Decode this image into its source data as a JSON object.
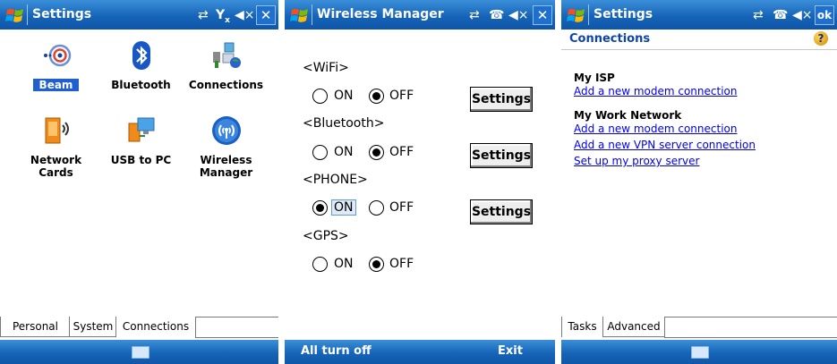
{
  "screen1": {
    "title": "Settings",
    "apps": [
      {
        "label": "Beam",
        "icon": "beam-icon"
      },
      {
        "label": "Bluetooth",
        "icon": "bluetooth-icon"
      },
      {
        "label": "Connections",
        "icon": "connections-icon"
      },
      {
        "label": "Network Cards",
        "icon": "network-cards-icon"
      },
      {
        "label": "USB to PC",
        "icon": "usb-to-pc-icon"
      },
      {
        "label": "Wireless Manager",
        "icon": "wireless-manager-icon"
      }
    ],
    "tabs": [
      "Personal",
      "System",
      "Connections"
    ]
  },
  "screen2": {
    "title": "Wireless Manager",
    "wifi_label": "<WiFi>",
    "bluetooth_label": "<Bluetooth>",
    "phone_label": "<PHONE>",
    "gps_label": "<GPS>",
    "on_label": "ON",
    "off_label": "OFF",
    "settings_label": "Settings",
    "states": {
      "wifi": "OFF",
      "bluetooth": "OFF",
      "phone": "ON",
      "gps": "OFF"
    },
    "softkey_left": "All turn off",
    "softkey_right": "Exit"
  },
  "screen3": {
    "title": "Settings",
    "ok_label": "ok",
    "page_header": "Connections",
    "help_label": "?",
    "group1": "My ISP",
    "group1_link": "Add a new modem connection",
    "group2": "My Work Network",
    "group2_links": [
      "Add a new modem connection",
      "Add a new VPN server connection",
      "Set up my proxy server"
    ],
    "tabs": [
      "Tasks",
      "Advanced"
    ]
  },
  "colors": {
    "titlebar": "#1664b8",
    "link": "#0000ee",
    "header_text": "#1144aa",
    "selection": "#1f5fd0"
  }
}
